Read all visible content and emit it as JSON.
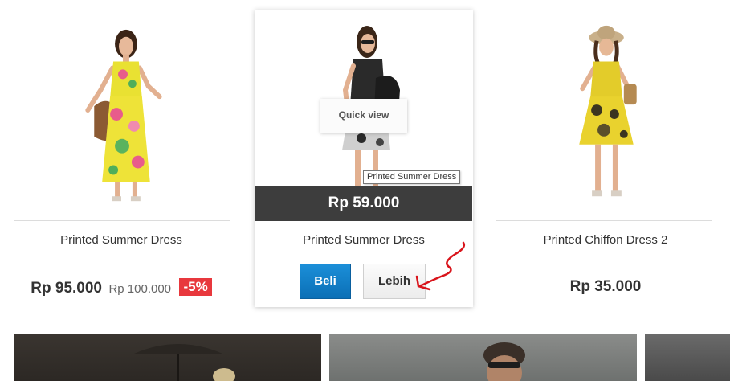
{
  "products": [
    {
      "name": "Printed Summer Dress",
      "price": "Rp 95.000",
      "old_price": "Rp 100.000",
      "discount": "-5%"
    },
    {
      "name": "Printed Summer Dress",
      "price": "Rp 59.000",
      "quick_view": "Quick view",
      "tooltip": "Printed Summer Dress",
      "buy_label": "Beli",
      "more_label": "Lebih"
    },
    {
      "name": "Printed Chiffon Dress 2",
      "price": "Rp 35.000"
    }
  ],
  "colors": {
    "buy_button": "#0b7bc6",
    "discount_badge": "#e8383d",
    "price_bar": "#3d3d3d",
    "annotation_arrow": "#d9141b"
  }
}
